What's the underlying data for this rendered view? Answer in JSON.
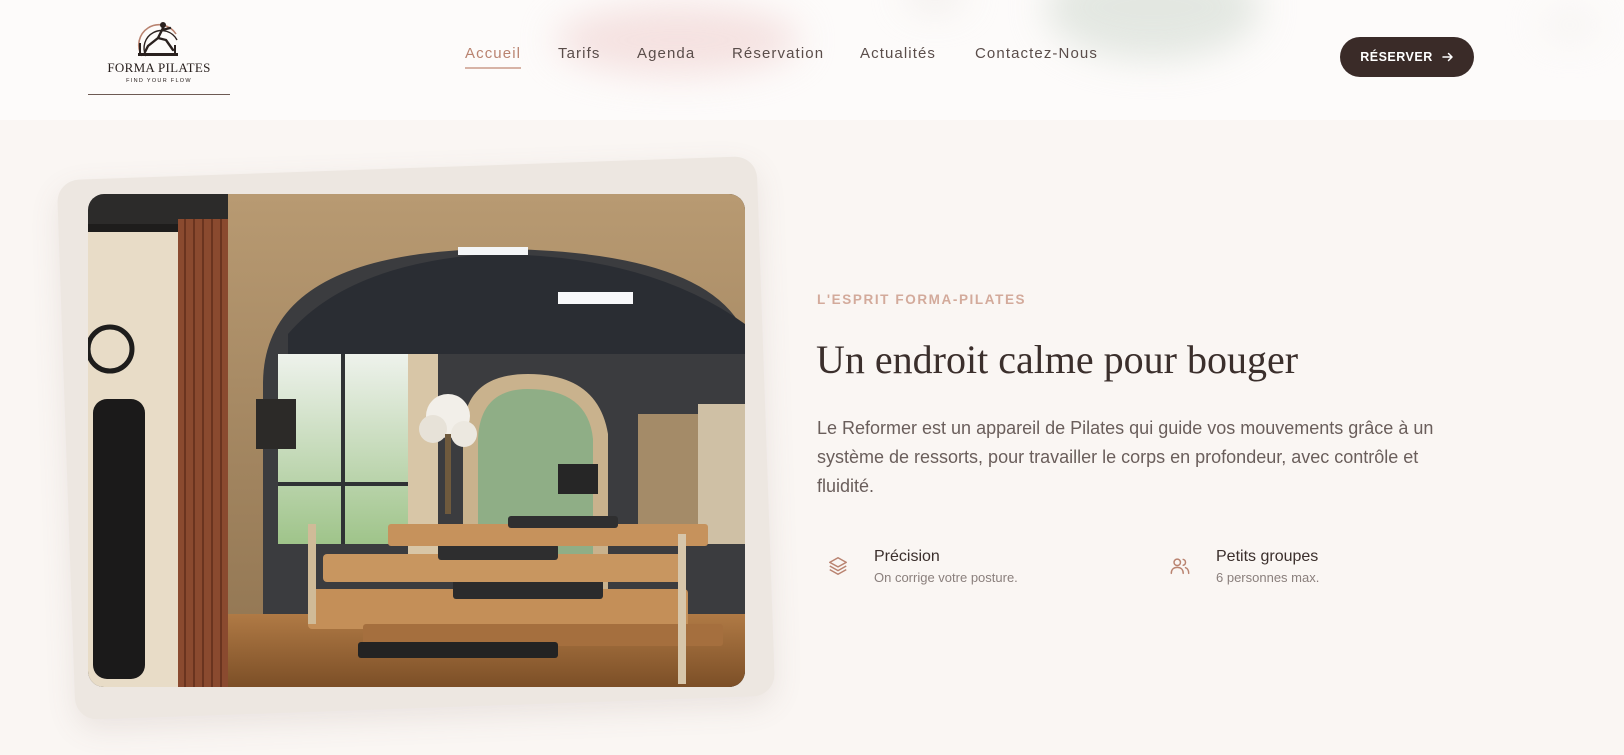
{
  "header": {
    "logo": {
      "name": "FORMA PILATES",
      "tagline": "FIND YOUR FLOW",
      "icon": "pilates-figure-icon"
    },
    "nav": [
      {
        "label": "Accueil",
        "active": true
      },
      {
        "label": "Tarifs",
        "active": false
      },
      {
        "label": "Agenda",
        "active": false
      },
      {
        "label": "Réservation",
        "active": false
      },
      {
        "label": "Actualités",
        "active": false
      },
      {
        "label": "Contactez-Nous",
        "active": false
      }
    ],
    "cta": {
      "label": "RÉSERVER",
      "icon": "arrow-right-icon"
    }
  },
  "main": {
    "eyebrow": "L'ESPRIT FORMA-PILATES",
    "headline": "Un endroit calme pour bouger",
    "body": "Le Reformer est un appareil de Pilates qui guide vos mouvements grâce à un système de ressorts, pour travailler le corps en profondeur, avec contrôle et fluidité.",
    "features": [
      {
        "icon": "layers-icon",
        "title": "Précision",
        "subtitle": "On corrige votre posture."
      },
      {
        "icon": "users-icon",
        "title": "Petits groupes",
        "subtitle": "6 personnes max."
      }
    ]
  },
  "colors": {
    "page_background": "#faf6f3",
    "header_background": "#fdfbfa",
    "accent": "#b98370",
    "eyebrow": "#d3aa9b",
    "cta_background": "#3a2b28",
    "heading": "#3b2f2c"
  }
}
